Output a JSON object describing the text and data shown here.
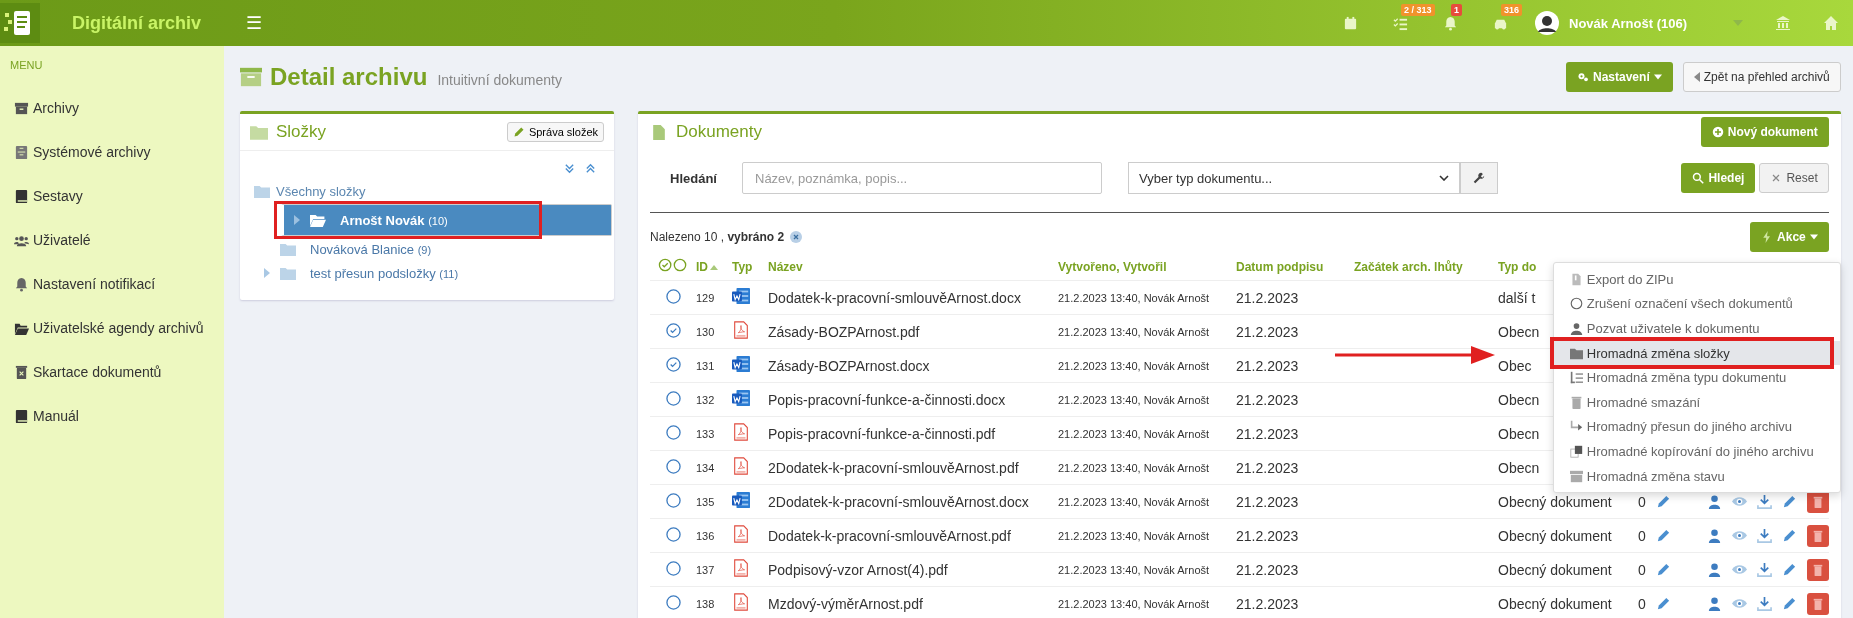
{
  "app": {
    "title": "Digitální archiv",
    "menu_glyph": "☰"
  },
  "topbar": {
    "items": [
      {
        "kind": "calendar"
      },
      {
        "kind": "tasks",
        "badge": "2 / 313",
        "color": "#f0932b"
      },
      {
        "kind": "bell",
        "badge": "1",
        "color": "#e74c3c"
      },
      {
        "kind": "car",
        "badge": "316",
        "color": "#f0932b"
      }
    ],
    "user": "Novák Arnošt (106)"
  },
  "sidebar": {
    "heading": "MENU",
    "items": [
      {
        "label": "Archivy",
        "kind": "archive"
      },
      {
        "label": "Systémové archivy",
        "kind": "cabinet"
      },
      {
        "label": "Sestavy",
        "kind": "book"
      },
      {
        "label": "Uživatelé",
        "kind": "users"
      },
      {
        "label": "Nastavení notifikací",
        "kind": "bell"
      },
      {
        "label": "Uživatelské agendy archivů",
        "kind": "folder"
      },
      {
        "label": "Skartace dokumentů",
        "kind": "trash"
      },
      {
        "label": "Manuál",
        "kind": "book"
      }
    ]
  },
  "header": {
    "title": "Detail archivu",
    "subtitle": "Intuitivní dokumenty",
    "settings_button": "Nastavení",
    "back_button": "Zpět na přehled archivů"
  },
  "folders": {
    "title": "Složky",
    "manage_button": "Správa složek",
    "tree": [
      {
        "label": "Všechny složky",
        "children": [
          {
            "label": "Arnošt Novák",
            "count": "(10)",
            "selected": true,
            "expandable": true
          },
          {
            "label": "Nováková Blanice",
            "count": "(9)",
            "selected": false,
            "expandable": false
          },
          {
            "label": "test přesun podsložky",
            "count": "(11)",
            "selected": false,
            "expandable": true
          }
        ]
      }
    ]
  },
  "documents": {
    "title": "Dokumenty",
    "new_button": "Nový dokument",
    "search": {
      "label": "Hledání",
      "placeholder": "Název, poznámka, popis...",
      "type_placeholder": "Vyber typ dokumentu...",
      "search_button": "Hledej",
      "reset_button": "Reset"
    },
    "found": "Nalezeno 10 , **vybráno 2**",
    "actions_button": "Akce",
    "columns": [
      {
        "label": "ID",
        "sorted": true
      },
      {
        "label": "Typ",
        "sorted": false
      },
      {
        "label": "Název",
        "sorted": false
      },
      {
        "label": "Vytvořeno, Vytvořil",
        "sorted": false
      },
      {
        "label": "Datum podpisu",
        "sorted": false
      },
      {
        "label": "Začátek arch. lhůty",
        "sorted": false
      },
      {
        "label": "Typ do",
        "sorted": false
      }
    ],
    "rows": [
      {
        "id": "129",
        "kind": "word",
        "name": "Dodatek-k-pracovní-smlouvěArnost.docx",
        "created": "21.2.2023 13:40, Novák Arnošt",
        "signed": "21.2.2023",
        "type": "další t",
        "selected": false
      },
      {
        "id": "130",
        "kind": "pdf",
        "name": "Zásady-BOZPArnost.pdf",
        "created": "21.2.2023 13:40, Novák Arnošt",
        "signed": "21.2.2023",
        "type": "Obecn",
        "selected": true
      },
      {
        "id": "131",
        "kind": "word",
        "name": "Zásady-BOZPArnost.docx",
        "created": "21.2.2023 13:40, Novák Arnošt",
        "signed": "21.2.2023",
        "type": "Obec",
        "selected": true
      },
      {
        "id": "132",
        "kind": "word",
        "name": "Popis-pracovní-funkce-a-činnosti.docx",
        "created": "21.2.2023 13:40, Novák Arnošt",
        "signed": "21.2.2023",
        "type": "Obecn",
        "selected": false
      },
      {
        "id": "133",
        "kind": "pdf",
        "name": "Popis-pracovní-funkce-a-činnosti.pdf",
        "created": "21.2.2023 13:40, Novák Arnošt",
        "signed": "21.2.2023",
        "type": "Obecn",
        "selected": false
      },
      {
        "id": "134",
        "kind": "pdf",
        "name": "2Dodatek-k-pracovní-smlouvěArnost.pdf",
        "created": "21.2.2023 13:40, Novák Arnošt",
        "signed": "21.2.2023",
        "type": "Obecn",
        "selected": false
      },
      {
        "id": "135",
        "kind": "word",
        "name": "2Dodatek-k-pracovní-smlouvěArnost.docx",
        "created": "21.2.2023 13:40, Novák Arnošt",
        "signed": "21.2.2023",
        "type": "Obecný dokument",
        "count": "0",
        "selected": false
      },
      {
        "id": "136",
        "kind": "pdf",
        "name": "Dodatek-k-pracovní-smlouvěArnost.pdf",
        "created": "21.2.2023 13:40, Novák Arnošt",
        "signed": "21.2.2023",
        "type": "Obecný dokument",
        "count": "0",
        "selected": false
      },
      {
        "id": "137",
        "kind": "pdf",
        "name": "Podpisový-vzor Arnost(4).pdf",
        "created": "21.2.2023 13:40, Novák Arnošt",
        "signed": "21.2.2023",
        "type": "Obecný dokument",
        "count": "0",
        "selected": false
      },
      {
        "id": "138",
        "kind": "pdf",
        "name": "Mzdový-výměrArnost.pdf",
        "created": "21.2.2023 13:40, Novák Arnošt",
        "signed": "21.2.2023",
        "type": "Obecný dokument",
        "count": "0",
        "selected": false
      }
    ],
    "menu": [
      {
        "label": "Export do ZIPu",
        "kind": "zip",
        "selected": false
      },
      {
        "label": "Zrušení označení všech dokumentů",
        "kind": "circle",
        "selected": false
      },
      {
        "label": "Pozvat uživatele k dokumentu",
        "kind": "user",
        "selected": false
      },
      {
        "label": "Hromadná změna složky",
        "kind": "folder",
        "selected": true
      },
      {
        "label": "Hromadná změna typu dokumentu",
        "kind": "list",
        "selected": false
      },
      {
        "label": "Hromadné smazání",
        "kind": "trash",
        "selected": false
      },
      {
        "label": "Hromadný přesun do jiného archivu",
        "kind": "move",
        "selected": false
      },
      {
        "label": "Hromadné kopírování do jiného archivu",
        "kind": "copy",
        "selected": false
      },
      {
        "label": "Hromadná změna stavu",
        "kind": "archive",
        "selected": false
      }
    ]
  }
}
